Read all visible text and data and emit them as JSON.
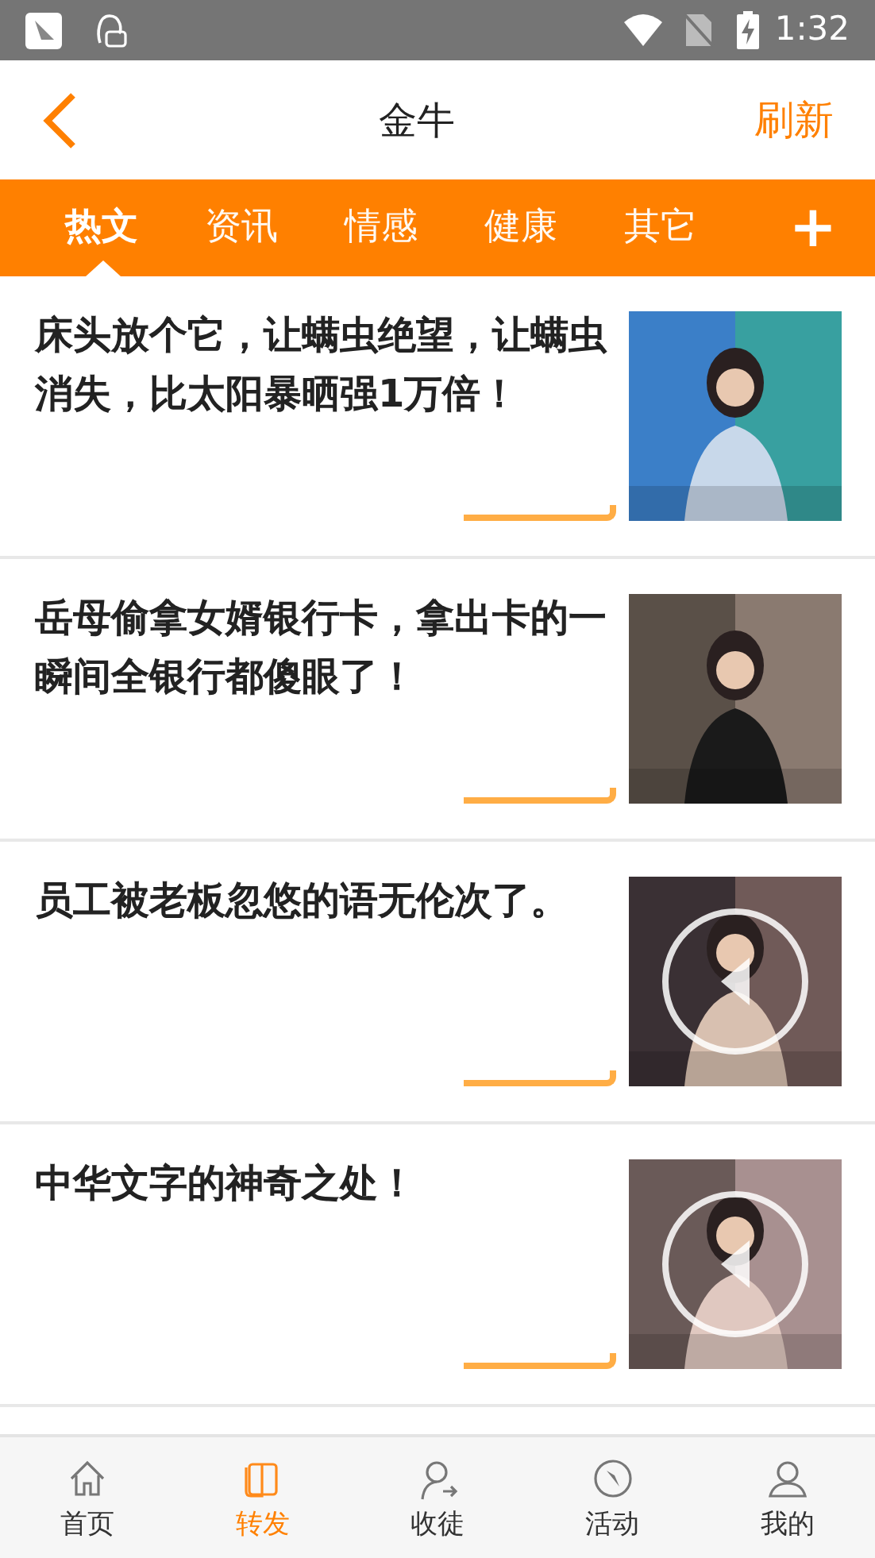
{
  "status_bar": {
    "time": "1:32"
  },
  "header": {
    "title": "金牛",
    "action": "刷新"
  },
  "tabs": [
    {
      "label": "热文",
      "selected": true
    },
    {
      "label": "资讯",
      "selected": false
    },
    {
      "label": "情感",
      "selected": false
    },
    {
      "label": "健康",
      "selected": false
    },
    {
      "label": "其它",
      "selected": false
    }
  ],
  "add_tab": "+",
  "articles": [
    {
      "title": "床头放个它，让螨虫绝望，让螨虫消失，比太阳暴晒强1万倍！",
      "video": false
    },
    {
      "title": "岳母偷拿女婿银行卡，拿出卡的一瞬间全银行都傻眼了！",
      "video": false
    },
    {
      "title": "员工被老板忽悠的语无伦次了。",
      "video": true
    },
    {
      "title": "中华文字的神奇之处！",
      "video": true
    }
  ],
  "bottom_nav": [
    {
      "label": "首页",
      "selected": false
    },
    {
      "label": "转发",
      "selected": true
    },
    {
      "label": "收徒",
      "selected": false
    },
    {
      "label": "活动",
      "selected": false
    },
    {
      "label": "我的",
      "selected": false
    }
  ]
}
